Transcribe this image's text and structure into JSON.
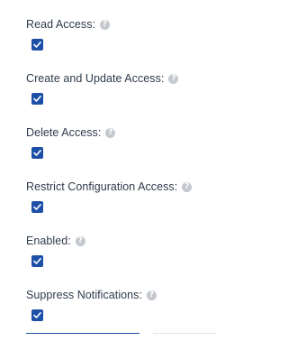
{
  "fields": [
    {
      "label": "Read Access:",
      "help_icon": "question-circle-icon",
      "checked": true
    },
    {
      "label": "Create and Update Access:",
      "help_icon": "question-circle-icon",
      "checked": true
    },
    {
      "label": "Delete Access:",
      "help_icon": "question-circle-icon",
      "checked": true
    },
    {
      "label": "Restrict Configuration Access:",
      "help_icon": "question-circle-icon",
      "checked": true
    },
    {
      "label": "Enabled:",
      "help_icon": "question-circle-icon",
      "checked": true
    },
    {
      "label": "Suppress Notifications:",
      "help_icon": "question-circle-icon",
      "checked": true
    }
  ],
  "help_icon_glyph": "?",
  "colors": {
    "checkbox_accent": "#1d4fa6",
    "label_text": "#2f3b4c",
    "help_icon": "#c4c9cf"
  }
}
